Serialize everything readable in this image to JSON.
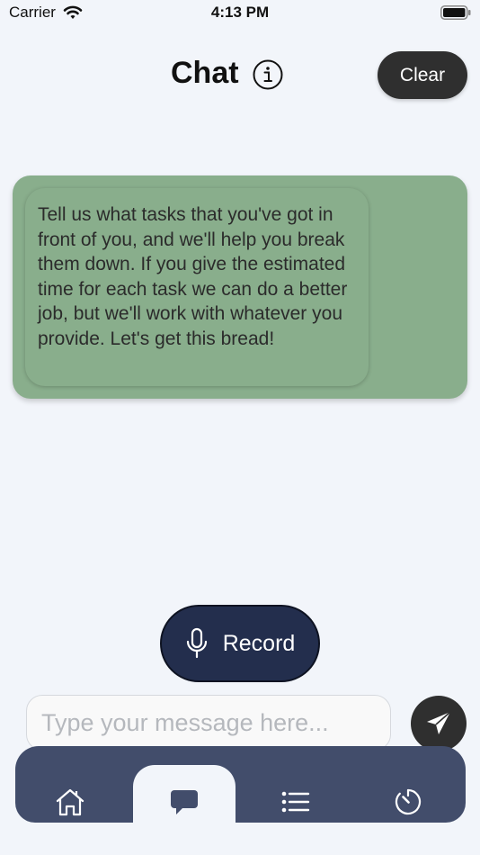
{
  "status_bar": {
    "carrier": "Carrier",
    "time": "4:13 PM",
    "icons": [
      "wifi-icon",
      "battery-icon"
    ]
  },
  "header": {
    "title": "Chat",
    "info_icon": "info-icon",
    "clear_label": "Clear"
  },
  "messages": [
    {
      "sender": "assistant",
      "text": "Tell us what tasks that you've got in front of you, and we'll help you break them down. If you give the estimated time for each task we can do a better job, but we'll work with whatever you provide. Let's get this bread!"
    }
  ],
  "record": {
    "label": "Record",
    "icon": "mic-icon"
  },
  "composer": {
    "placeholder": "Type your message here...",
    "value": "",
    "send_icon": "send-icon"
  },
  "tabs": [
    {
      "name": "home",
      "icon": "home-icon",
      "selected": false
    },
    {
      "name": "chat",
      "icon": "chat-icon",
      "selected": true
    },
    {
      "name": "list",
      "icon": "list-icon",
      "selected": false
    },
    {
      "name": "timer",
      "icon": "timer-icon",
      "selected": false
    }
  ],
  "colors": {
    "background": "#f2f5fa",
    "message_bg": "#89ae8c",
    "record_bg": "#232e4d",
    "tabbar_bg": "#424d6b",
    "dark_button": "#2f2f2f"
  }
}
